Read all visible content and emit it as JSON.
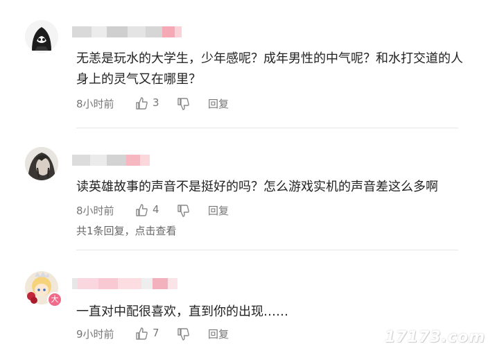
{
  "comments": [
    {
      "text": "无恙是玩水的大学生，少年感呢？成年男性的中气呢？和水打交道的人身上的灵气又在哪里？",
      "time": "8小时前",
      "likes": "3",
      "reply_label": "回复"
    },
    {
      "text": "读英雄故事的声音不是挺好的吗？怎么游戏实机的声音差这么多啊",
      "time": "8小时前",
      "likes": "4",
      "reply_label": "回复",
      "replies_link": "共1条回复，点击查看"
    },
    {
      "text": "一直对中配很喜欢，直到你的出现……",
      "time": "9小时前",
      "likes": "7",
      "reply_label": "回复",
      "badge": "大"
    }
  ],
  "watermark": "17173.com",
  "colors": {
    "text": "#222222",
    "meta": "#777777",
    "divider": "#e6e6e6",
    "blur_pink": "#f6b3bf"
  }
}
